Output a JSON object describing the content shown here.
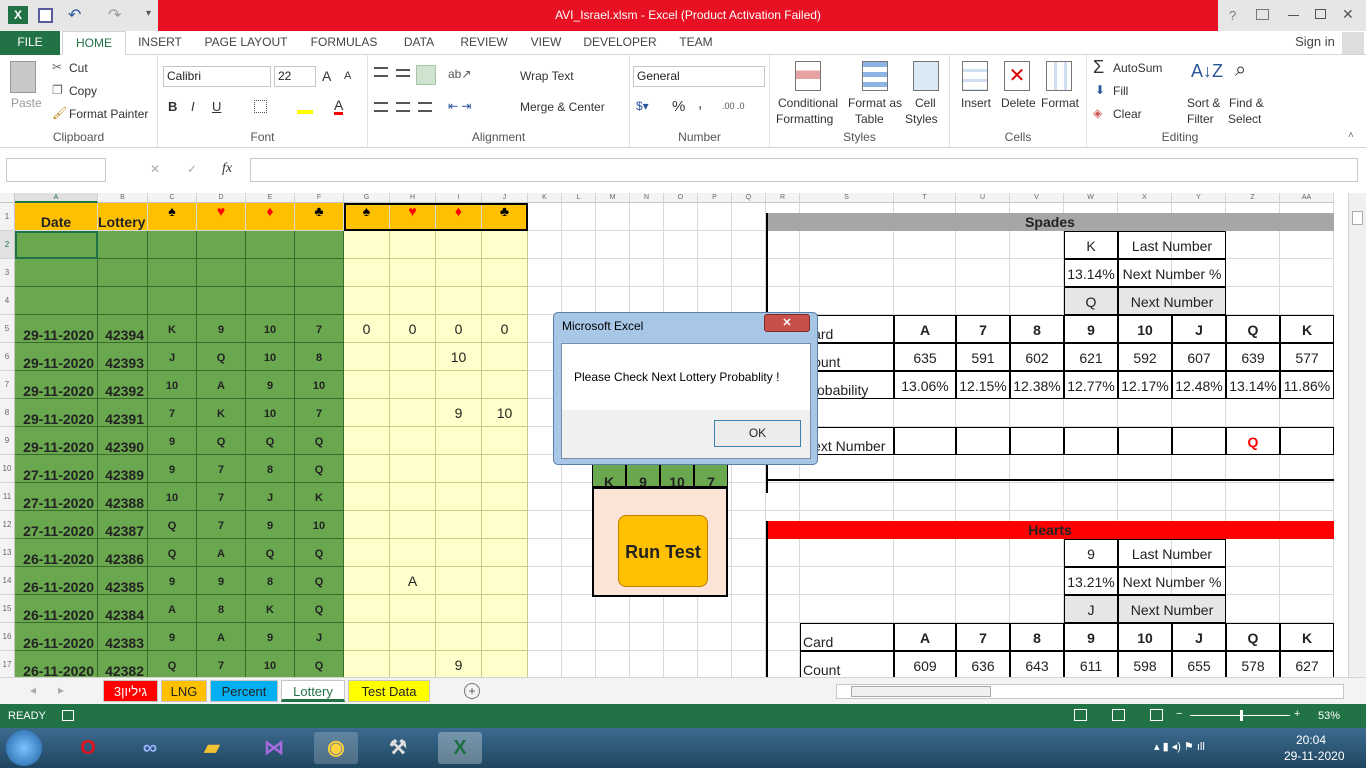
{
  "window": {
    "title": "AVI_Israel.xlsm  -  Excel (Product Activation Failed)",
    "help": "?",
    "signin": "Sign in"
  },
  "ribbon": {
    "tabs": [
      "FILE",
      "HOME",
      "INSERT",
      "PAGE LAYOUT",
      "FORMULAS",
      "DATA",
      "REVIEW",
      "VIEW",
      "DEVELOPER",
      "TEAM"
    ],
    "clipboard": {
      "paste": "Paste",
      "cut": "Cut",
      "copy": "Copy",
      "format_painter": "Format Painter",
      "label": "Clipboard"
    },
    "font": {
      "name": "Calibri",
      "size": "22",
      "bold": "B",
      "italic": "I",
      "underline": "U",
      "grow": "A",
      "shrink": "A",
      "color_letter": "A",
      "label": "Font"
    },
    "alignment": {
      "wrap": "Wrap Text",
      "merge": "Merge & Center",
      "label": "Alignment"
    },
    "number": {
      "format": "General",
      "percent": "%",
      "comma": ",",
      "label": "Number"
    },
    "styles": {
      "conditional1": "Conditional",
      "conditional2": "Formatting",
      "format_table1": "Format as",
      "format_table2": "Table",
      "cell_styles1": "Cell",
      "cell_styles2": "Styles",
      "label": "Styles"
    },
    "cells": {
      "insert": "Insert",
      "delete": "Delete",
      "format": "Format",
      "label": "Cells"
    },
    "editing": {
      "autosum": "AutoSum",
      "fill": "Fill",
      "clear": "Clear",
      "sort1": "Sort &",
      "sort2": "Filter",
      "find1": "Find &",
      "find2": "Select",
      "label": "Editing"
    }
  },
  "formula_bar": {
    "name_box": "",
    "fx": "fx",
    "cancel": "✕",
    "enter": "✓",
    "formula": ""
  },
  "columns": [
    "A",
    "B",
    "C",
    "D",
    "E",
    "F",
    "G",
    "H",
    "I",
    "J",
    "K",
    "L",
    "M",
    "N",
    "O",
    "P",
    "Q",
    "R",
    "S",
    "T",
    "U",
    "V",
    "W",
    "X",
    "Y",
    "Z",
    "AA"
  ],
  "rows": [
    "1",
    "2",
    "3",
    "4",
    "5",
    "6",
    "7",
    "8",
    "9",
    "10",
    "11",
    "12",
    "13",
    "14",
    "15",
    "16",
    "17"
  ],
  "lottery": {
    "header_date": "Date",
    "header_lottery": "Lottery",
    "suits": [
      "♠",
      "♥",
      "♦",
      "♣"
    ],
    "records": [
      {
        "date": "29-11-2020",
        "id": "42394",
        "cards": [
          "K",
          "9",
          "10",
          "7"
        ],
        "hits": [
          "0",
          "0",
          "0",
          "0"
        ]
      },
      {
        "date": "29-11-2020",
        "id": "42393",
        "cards": [
          "J",
          "Q",
          "10",
          "8"
        ],
        "hits": [
          "",
          "",
          "10",
          ""
        ]
      },
      {
        "date": "29-11-2020",
        "id": "42392",
        "cards": [
          "10",
          "A",
          "9",
          "10"
        ],
        "hits": [
          "",
          "",
          "",
          ""
        ]
      },
      {
        "date": "29-11-2020",
        "id": "42391",
        "cards": [
          "7",
          "K",
          "10",
          "7"
        ],
        "hits": [
          "",
          "",
          "9",
          "10"
        ]
      },
      {
        "date": "29-11-2020",
        "id": "42390",
        "cards": [
          "9",
          "Q",
          "Q",
          "Q"
        ],
        "hits": [
          "",
          "",
          "",
          ""
        ]
      },
      {
        "date": "27-11-2020",
        "id": "42389",
        "cards": [
          "9",
          "7",
          "8",
          "Q"
        ],
        "hits": [
          "",
          "",
          "",
          ""
        ]
      },
      {
        "date": "27-11-2020",
        "id": "42388",
        "cards": [
          "10",
          "7",
          "J",
          "K"
        ],
        "hits": [
          "",
          "",
          "",
          ""
        ]
      },
      {
        "date": "27-11-2020",
        "id": "42387",
        "cards": [
          "Q",
          "7",
          "9",
          "10"
        ],
        "hits": [
          "",
          "",
          "",
          ""
        ]
      },
      {
        "date": "26-11-2020",
        "id": "42386",
        "cards": [
          "Q",
          "A",
          "Q",
          "Q"
        ],
        "hits": [
          "",
          "",
          "",
          ""
        ]
      },
      {
        "date": "26-11-2020",
        "id": "42385",
        "cards": [
          "9",
          "9",
          "8",
          "Q"
        ],
        "hits": [
          "",
          "A",
          "",
          ""
        ]
      },
      {
        "date": "26-11-2020",
        "id": "42384",
        "cards": [
          "A",
          "8",
          "K",
          "Q"
        ],
        "hits": [
          "",
          "",
          "",
          ""
        ]
      },
      {
        "date": "26-11-2020",
        "id": "42383",
        "cards": [
          "9",
          "A",
          "9",
          "J"
        ],
        "hits": [
          "",
          "",
          "",
          ""
        ]
      },
      {
        "date": "26-11-2020",
        "id": "42382",
        "cards": [
          "Q",
          "7",
          "10",
          "Q"
        ],
        "hits": [
          "",
          "",
          "9",
          ""
        ]
      }
    ]
  },
  "prediction_row": [
    "K",
    "9",
    "10",
    "7"
  ],
  "run_test": "Run Test",
  "spades": {
    "title": "Spades",
    "last_card": "K",
    "last_label": "Last Number",
    "pct": "13.14%",
    "pct_label": "Next Number %",
    "next_card": "Q",
    "next_label": "Next Number",
    "card_label": "Card",
    "count_label": "Count",
    "prob_label": "Probability",
    "next_number_label": "Next Number",
    "cards": [
      "A",
      "7",
      "8",
      "9",
      "10",
      "J",
      "Q",
      "K"
    ],
    "counts": [
      "635",
      "591",
      "602",
      "621",
      "592",
      "607",
      "639",
      "577"
    ],
    "probs": [
      "13.06%",
      "12.15%",
      "12.38%",
      "12.77%",
      "12.17%",
      "12.48%",
      "13.14%",
      "11.86%"
    ],
    "next_marker": "Q"
  },
  "hearts": {
    "title": "Hearts",
    "last_card": "9",
    "last_label": "Last Number",
    "pct": "13.21%",
    "pct_label": "Next Number %",
    "next_card": "J",
    "next_label": "Next Number",
    "card_label": "Card",
    "count_label": "Count",
    "cards": [
      "A",
      "7",
      "8",
      "9",
      "10",
      "J",
      "Q",
      "K"
    ],
    "counts": [
      "609",
      "636",
      "643",
      "611",
      "598",
      "655",
      "578",
      "627"
    ]
  },
  "dialog": {
    "title": "Microsoft Excel",
    "message": "Please Check Next Lottery Probablity !",
    "ok": "OK",
    "close": "✕"
  },
  "sheet_tabs": [
    "גיליון3",
    "LNG",
    "Percent",
    "Lottery",
    "Test Data"
  ],
  "status": {
    "ready": "READY",
    "zoom": "53%"
  },
  "taskbar": {
    "time": "20:04",
    "date": "29-11-2020"
  },
  "colors": {
    "excel_green": "#217346",
    "title_red": "#e81123",
    "grid_green": "#6aa84f",
    "orange": "#ffc000",
    "pale_yellow": "#ffffcc",
    "hearts_red": "#ff0000"
  }
}
